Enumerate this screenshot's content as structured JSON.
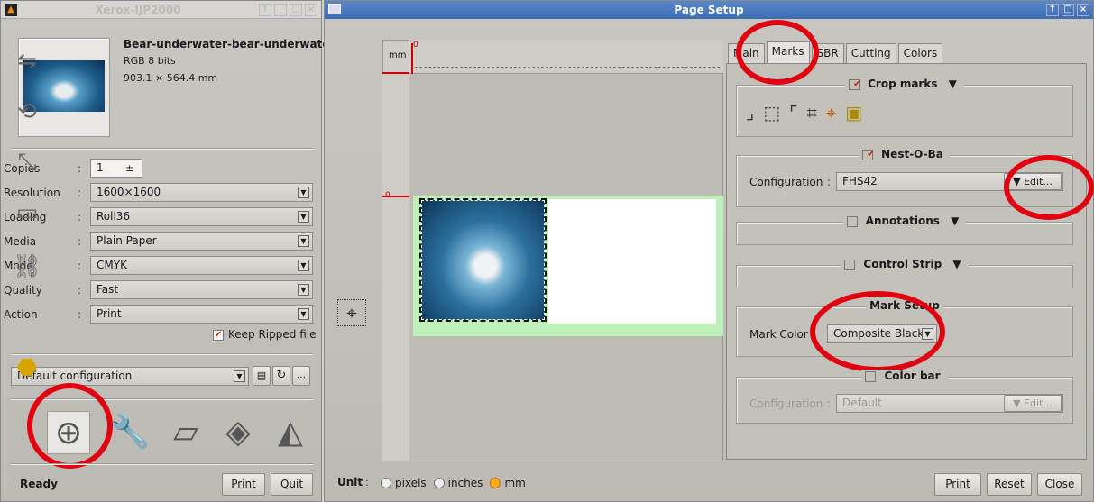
{
  "left_window": {
    "title": "Xerox-IJP2000",
    "controls": [
      "↑",
      "_",
      "□",
      "×"
    ],
    "file": {
      "name": "Bear-underwater-bear-underwater-",
      "color": "RGB 8 bits",
      "size": "903.1 × 564.4 mm"
    },
    "fields": [
      {
        "label": "Copies",
        "value": "1"
      },
      {
        "label": "Resolution",
        "value": "1600×1600"
      },
      {
        "label": "Loading",
        "value": "Roll36"
      },
      {
        "label": "Media",
        "value": "Plain Paper"
      },
      {
        "label": "Mode",
        "value": "CMYK"
      },
      {
        "label": "Quality",
        "value": "Fast"
      },
      {
        "label": "Action",
        "value": "Print"
      }
    ],
    "keep_ripped": "Keep Ripped file",
    "config": "Default configuration",
    "status": "Ready",
    "print": "Print",
    "quit": "Quit"
  },
  "right_window": {
    "title": "Page Setup",
    "controls": [
      "↑",
      "□",
      "×"
    ],
    "ruler_unit": "mm",
    "ruler_zero": "0",
    "tabs": [
      "Main",
      "Marks",
      "SBR",
      "Cutting",
      "Colors"
    ],
    "crop_marks": "Crop marks",
    "nest": "Nest-O-Ba",
    "config_label": "Configuration",
    "config_value": "FHS42",
    "edit": "Edit...",
    "annotations": "Annotations",
    "control_strip": "Control Strip",
    "mark_setup": "Mark Setup",
    "mark_color_label": "Mark Color",
    "mark_color_value": "Composite Black",
    "color_bar": "Color bar",
    "cb_config_label": "Configuration",
    "cb_config_value": "Default",
    "cb_edit": "Edit...",
    "unit_label": "Unit",
    "units": [
      "pixels",
      "inches",
      "mm"
    ],
    "print": "Print",
    "reset": "Reset",
    "close": "Close"
  }
}
